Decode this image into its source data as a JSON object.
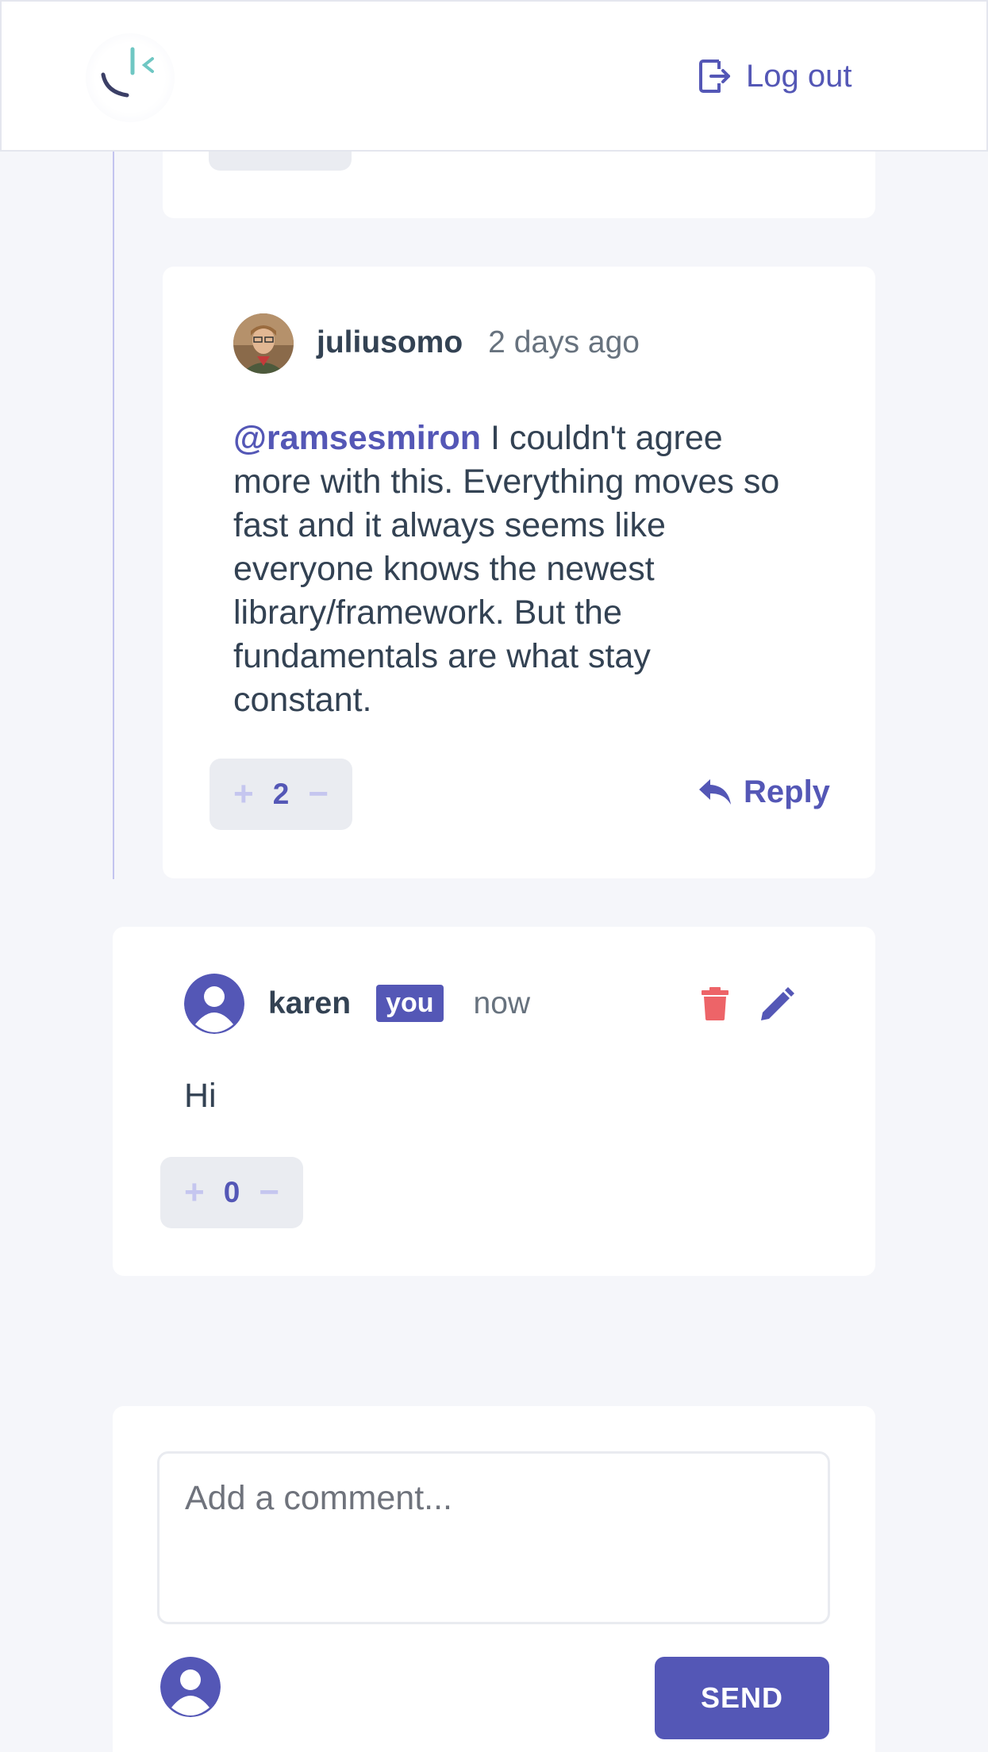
{
  "header": {
    "logout_label": "Log out"
  },
  "reply_comment": {
    "username": "juliusomo",
    "timestamp": "2 days ago",
    "mention": "@ramsesmiron",
    "text": " I couldn't agree more with this. Everything moves so fast and it always seems like everyone knows the newest library/framework. But the fundamentals are what stay constant.",
    "score": "2",
    "reply_label": "Reply"
  },
  "own_comment": {
    "username": "karen",
    "you_label": "you",
    "timestamp": "now",
    "text": "Hi",
    "score": "0"
  },
  "add_comment": {
    "placeholder": "Add a comment...",
    "send_label": "SEND"
  },
  "colors": {
    "accent": "#5457b6",
    "accent_light": "#c5c6ef",
    "danger": "#ed6468",
    "text": "#334253",
    "background": "#f5f6fa"
  }
}
